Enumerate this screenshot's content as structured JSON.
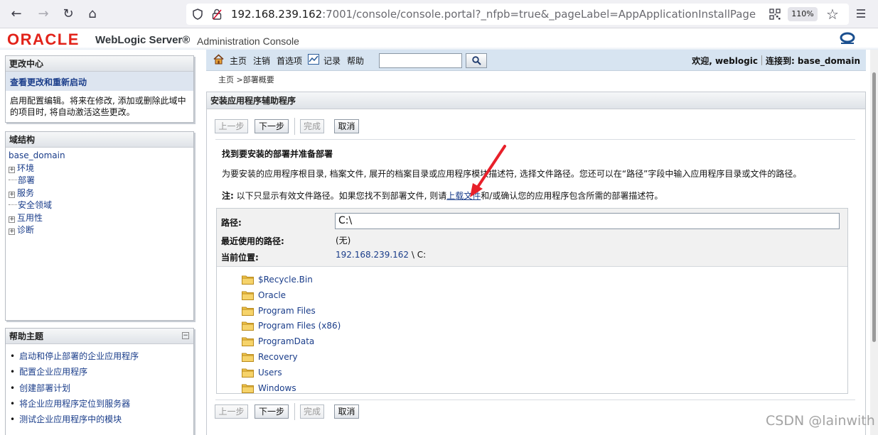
{
  "browser": {
    "url_host": "192.168.239.162",
    "url_rest": ":7001/console/console.portal?_nfpb=true&_pageLabel=AppApplicationInstallPage",
    "zoom": "110%"
  },
  "header": {
    "oracle_logo": "ORACLE",
    "product": "WebLogic Server®",
    "subtitle": "Administration Console"
  },
  "change_center": {
    "title": "更改中心",
    "link": "查看更改和重新启动",
    "text_line1": "启用配置编辑。将来在修改, 添加或删除此域中",
    "text_line2": "的项目时, 将自动激活这些更改。"
  },
  "domain_structure": {
    "title": "域结构",
    "root": "base_domain",
    "items": [
      {
        "label": "环境",
        "expandable": true
      },
      {
        "label": "部署",
        "expandable": false
      },
      {
        "label": "服务",
        "expandable": true
      },
      {
        "label": "安全领域",
        "expandable": false
      },
      {
        "label": "互用性",
        "expandable": true
      },
      {
        "label": "诊断",
        "expandable": true
      }
    ]
  },
  "help_topics": {
    "title": "帮助主题",
    "items": [
      "启动和停止部署的企业应用程序",
      "配置企业应用程序",
      "创建部署计划",
      "将企业应用程序定位到服务器",
      "测试企业应用程序中的模块"
    ]
  },
  "topnav": {
    "home": "主页",
    "logout": "注销",
    "preferences": "首选项",
    "record": "记录",
    "help": "帮助",
    "welcome": "欢迎, weblogic",
    "connected": "连接到: base_domain"
  },
  "breadcrumb": "主页 >部署概要",
  "main": {
    "title": "安装应用程序辅助程序",
    "buttons": {
      "back": "上一步",
      "next": "下一步",
      "finish": "完成",
      "cancel": "取消"
    },
    "heading": "找到要安装的部署并准备部署",
    "description": "为要安装的应用程序根目录, 档案文件, 展开的档案目录或应用程序模块描述符, 选择文件路径。您还可以在“路径”字段中输入应用程序目录或文件的路径。",
    "note_label": "注:",
    "note_before": " 以下只显示有效文件路径。如果您找不到部署文件, 则请",
    "note_link": "上载文件",
    "note_after": "和/或确认您的应用程序包含所需的部署描述符。",
    "path_label": "路径:",
    "path_value": "C:\\",
    "recent_label": "最近使用的路径:",
    "recent_value": "(无)",
    "location_label": "当前位置:",
    "location_host": "192.168.239.162",
    "location_sep": " \\ ",
    "location_drive": "C:",
    "folders": [
      "$Recycle.Bin",
      "Oracle",
      "Program Files",
      "Program Files (x86)",
      "ProgramData",
      "Recovery",
      "Users",
      "Windows"
    ]
  },
  "watermark": "CSDN @lainwith",
  "colors": {
    "oracle_red": "#e2231a",
    "link_blue": "#1a3d8a",
    "nav_bg": "#d7e4f1",
    "annotation_arrow": "#e8202a",
    "folder": "#f2c64a"
  }
}
